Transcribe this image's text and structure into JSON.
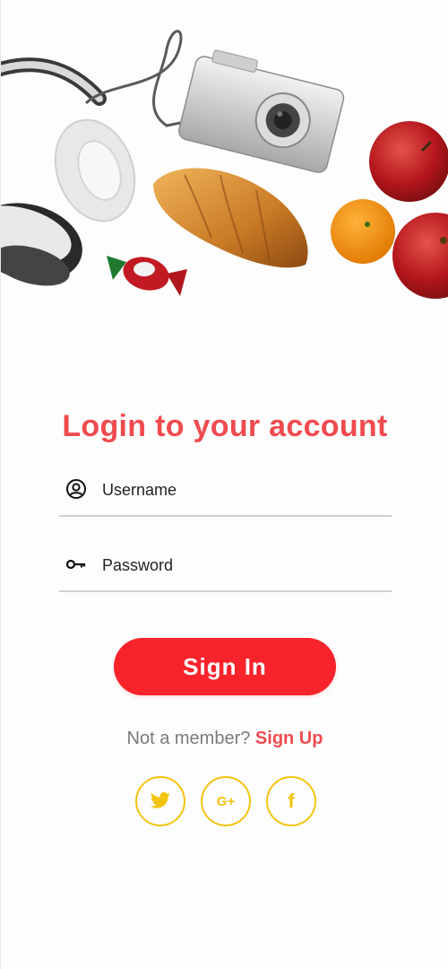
{
  "login": {
    "title": "Login to your account",
    "username_placeholder": "Username",
    "password_placeholder": "Password",
    "signin_label": "Sign In",
    "member_prompt": "Not a member?",
    "signup_label": "Sign Up"
  },
  "social": {
    "google_label": "G+",
    "facebook_label": "f"
  },
  "icons": {
    "username": "user-circle-icon",
    "password": "key-icon",
    "twitter": "twitter-icon",
    "google": "google-plus-icon",
    "facebook": "facebook-icon"
  },
  "colors": {
    "accent": "#ef4b4f",
    "button": "#f8232b",
    "social": "#f2c40f",
    "muted_text": "#7a7a7a"
  }
}
